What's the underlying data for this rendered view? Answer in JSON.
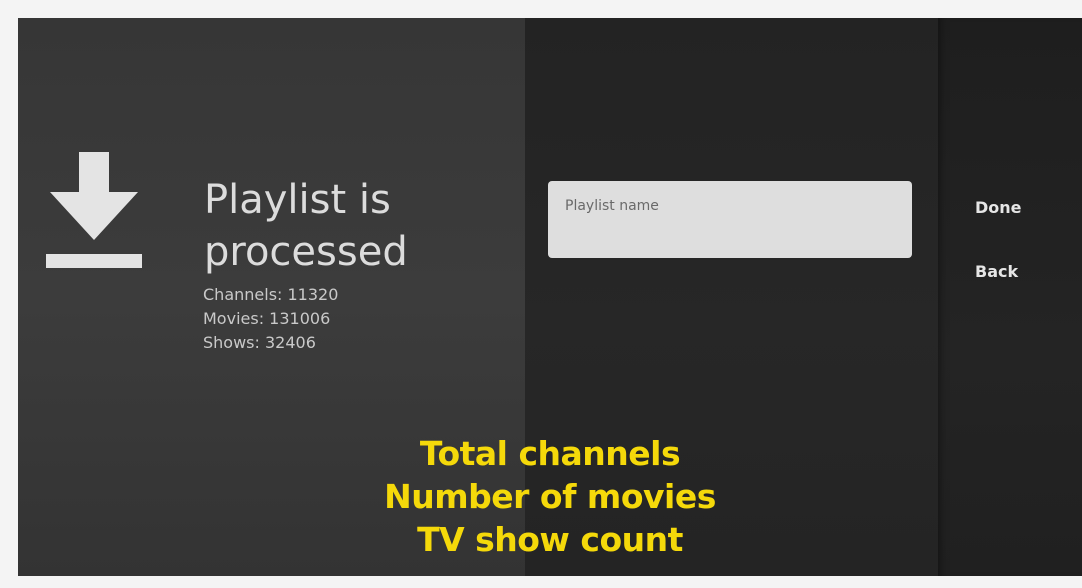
{
  "screen": {
    "icon": "download-icon",
    "title_line1": "Playlist is",
    "title_line2": "processed",
    "stats": {
      "channels": "Channels: 11320",
      "movies": "Movies: 131006",
      "shows": "Shows: 32406"
    }
  },
  "playlist_name_field": {
    "placeholder": "Playlist name",
    "value": ""
  },
  "actions": {
    "done_label": "Done",
    "back_label": "Back"
  },
  "caption": {
    "line1": "Total channels",
    "line2": "Number of movies",
    "line3": "TV show count",
    "color": "#f5d90a"
  }
}
